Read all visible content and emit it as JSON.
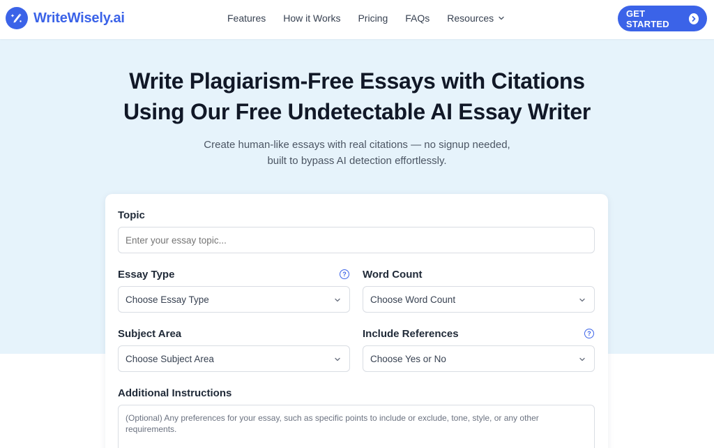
{
  "brand": {
    "name": "WriteWisely.ai",
    "accent": "#3b63e8"
  },
  "nav": {
    "items": [
      "Features",
      "How it Works",
      "Pricing",
      "FAQs",
      "Resources"
    ],
    "cta": "GET STARTED"
  },
  "hero": {
    "title_line1": "Write Plagiarism-Free Essays with Citations",
    "title_line2": "Using Our Free Undetectable AI Essay Writer",
    "subtitle_line1": "Create human-like essays with real citations — no signup needed,",
    "subtitle_line2": "built to bypass AI detection effortlessly."
  },
  "form": {
    "topic": {
      "label": "Topic",
      "placeholder": "Enter your essay topic..."
    },
    "essay_type": {
      "label": "Essay Type",
      "value": "Choose Essay Type"
    },
    "word_count": {
      "label": "Word Count",
      "value": "Choose Word Count"
    },
    "subject_area": {
      "label": "Subject Area",
      "value": "Choose Subject Area"
    },
    "include_references": {
      "label": "Include References",
      "value": "Choose Yes or No"
    },
    "additional": {
      "label": "Additional Instructions",
      "placeholder": "(Optional) Any preferences for your essay, such as specific points to include or exclude, tone, style, or any other requirements."
    },
    "help_glyph": "?"
  }
}
